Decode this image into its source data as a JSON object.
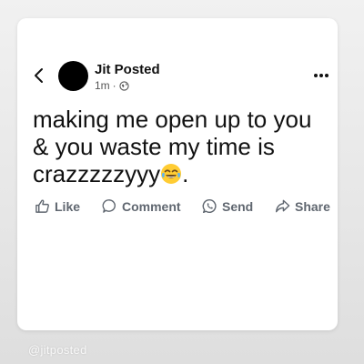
{
  "post": {
    "author": "Jit Posted",
    "time": "1m",
    "separator": "·",
    "text_lines": [
      "making me open up to you",
      "& you waste my time is",
      "crazzzzzyyy"
    ],
    "text_end": ".",
    "emoji_icon": "tears-of-joy-emoji"
  },
  "actions": {
    "like": "Like",
    "comment": "Comment",
    "send": "Send",
    "share": "Share"
  },
  "watermark": "@jitposted",
  "colors": {
    "card": "#ffffff",
    "background": "#e9e9e9",
    "text": "#111111",
    "action": "#606770"
  }
}
